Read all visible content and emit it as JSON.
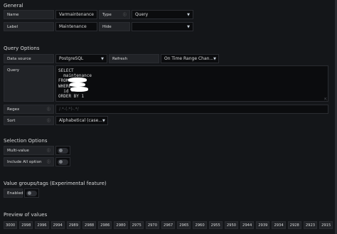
{
  "general": {
    "title": "General",
    "name_label": "Name",
    "name_value": "Varmaintenance",
    "type_label": "Type",
    "type_value": "Query",
    "label_label": "Label",
    "label_value": "Maintenance",
    "hide_label": "Hide",
    "hide_value": ""
  },
  "query_options": {
    "title": "Query Options",
    "datasource_label": "Data source",
    "datasource_value": "PostgreSQL",
    "refresh_label": "Refresh",
    "refresh_value": "On Time Range Chan...",
    "query_label": "Query",
    "query_lines": [
      "SELECT",
      "  maintenance",
      "FROM",
      "WHERE",
      "  id =",
      "ORDER BY 1"
    ],
    "regex_label": "Regex",
    "regex_placeholder": "/.*-(.*)-.*/",
    "sort_label": "Sort",
    "sort_value": "Alphabetical (case..."
  },
  "selection_options": {
    "title": "Selection Options",
    "multi_label": "Multi-value",
    "include_all_label": "Include All option"
  },
  "value_groups": {
    "title": "Value groups/tags (Experimental feature)",
    "enabled_label": "Enabled"
  },
  "preview": {
    "title": "Preview of values",
    "values": [
      "3000",
      "2998",
      "2996",
      "2994",
      "2989",
      "2988",
      "2986",
      "2980",
      "2975",
      "2970",
      "2967",
      "2965",
      "2960",
      "2955",
      "2950",
      "2944",
      "2939",
      "2934",
      "2928",
      "2923",
      "2915"
    ]
  },
  "colors": {
    "background": "#141619",
    "label_bg": "#212327",
    "input_bg": "#0b0c0e",
    "border": "#2a2c31"
  },
  "icons": [
    "info-icon",
    "chevron-down-icon",
    "resize-handle-icon"
  ]
}
